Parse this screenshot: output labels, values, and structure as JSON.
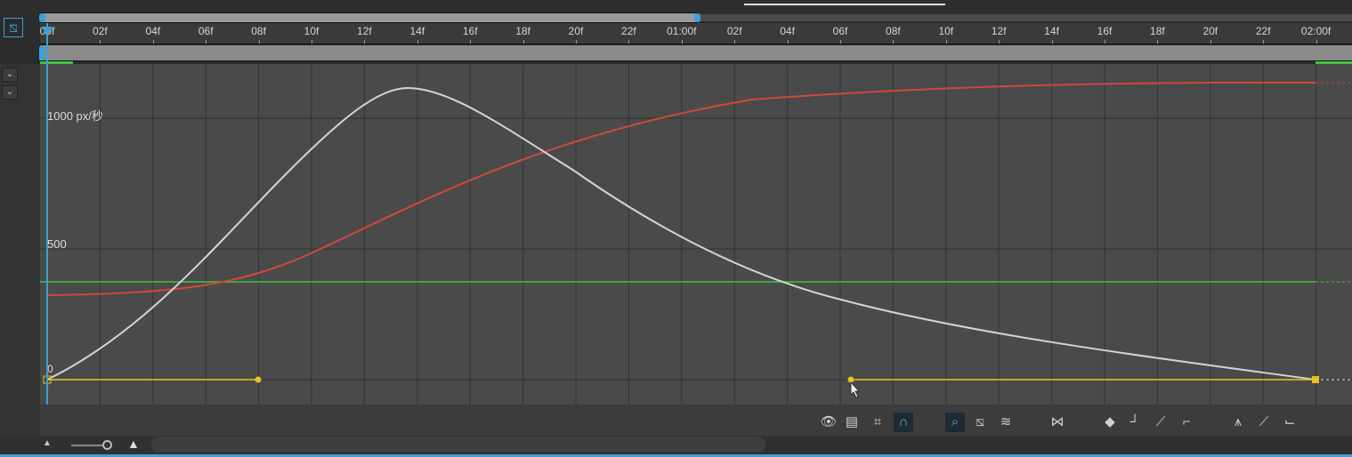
{
  "ruler": {
    "ticks": [
      "00f",
      "02f",
      "04f",
      "06f",
      "08f",
      "10f",
      "12f",
      "14f",
      "16f",
      "18f",
      "20f",
      "22f",
      "01:00f",
      "02f",
      "04f",
      "06f",
      "08f",
      "10f",
      "12f",
      "14f",
      "16f",
      "18f",
      "20f",
      "22f",
      "02:00f"
    ]
  },
  "graph": {
    "y_labels": [
      "1000 px/秒",
      "500",
      "0"
    ]
  },
  "colors": {
    "accent": "#3aa0d8",
    "speed_curve": "#d4d4d4",
    "red_curve": "#d0483a",
    "green_curve": "#3cc63c",
    "keyframe": "#e8c21c"
  },
  "toolbar": {
    "icons": [
      "show-properties-icon",
      "graph-type-icon",
      "transform-box-icon",
      "snap-icon",
      "auto-zoom-icon",
      "fit-selection-icon",
      "fit-all-icon",
      "separate-dimensions-icon",
      "edit-keyframe-icon",
      "hold-icon",
      "linear-icon",
      "auto-bezier-icon",
      "easy-ease-icon",
      "easy-ease-in-icon",
      "easy-ease-out-icon"
    ]
  }
}
